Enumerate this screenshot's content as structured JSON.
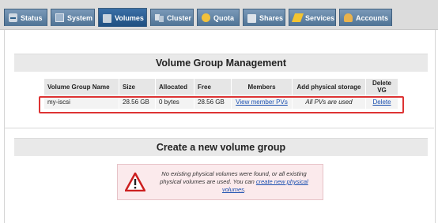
{
  "tabs": [
    {
      "label": "Status",
      "icon": "status-icon"
    },
    {
      "label": "System",
      "icon": "system-icon"
    },
    {
      "label": "Volumes",
      "icon": "volumes-icon",
      "active": true
    },
    {
      "label": "Cluster",
      "icon": "cluster-icon"
    },
    {
      "label": "Quota",
      "icon": "quota-icon"
    },
    {
      "label": "Shares",
      "icon": "shares-icon"
    },
    {
      "label": "Services",
      "icon": "services-icon"
    },
    {
      "label": "Accounts",
      "icon": "accounts-icon"
    }
  ],
  "vg_management": {
    "title": "Volume Group Management",
    "columns": [
      "Volume Group Name",
      "Size",
      "Allocated",
      "Free",
      "Members",
      "Add physical storage",
      "Delete VG"
    ],
    "rows": [
      {
        "name": "my-iscsi",
        "size": "28.56 GB",
        "allocated": "0 bytes",
        "free": "28.56 GB",
        "members_link": "View member PVs",
        "add_storage": "All PVs are used",
        "delete_link": "Delete"
      }
    ]
  },
  "create_vg": {
    "title": "Create a new volume group",
    "alert_text": "No existing physical volumes were found, or all existing physical volumes are used. You can",
    "alert_link": "create new physical volumes",
    "alert_end": "."
  },
  "colors": {
    "tab_bg": "#5b7fa3",
    "tab_active_bg": "#2a5d92",
    "highlight_border": "#dd3333",
    "link": "#1a4fb0",
    "alert_bg": "#fbeaec"
  }
}
